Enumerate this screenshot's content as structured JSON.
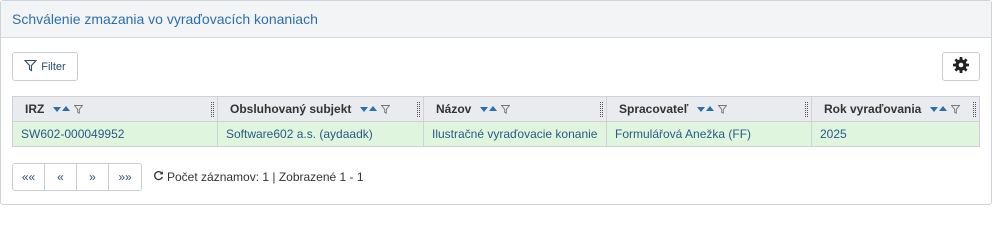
{
  "panel": {
    "title": "Schválenie zmazania vo vyraďovacích konaniach"
  },
  "toolbar": {
    "filter_label": "Filter",
    "filter_icon": "filter-icon",
    "settings_icon": "gear-icon"
  },
  "table": {
    "columns": [
      "IRZ",
      "Obsluhovaný subjekt",
      "Názov",
      "Spracovateľ",
      "Rok vyraďovania"
    ],
    "rows": [
      [
        "SW602-000049952",
        "Software602 a.s. (aydaadk)",
        "Ilustračné vyraďovacie konanie",
        "Formulářová Anežka (FF)",
        "2025"
      ]
    ]
  },
  "pager": {
    "first": "««",
    "prev": "«",
    "next": "»",
    "last": "»»"
  },
  "status": {
    "text": "Počet záznamov: 1 | Zobrazené 1 - 1",
    "icon": "refresh-icon"
  },
  "colors": {
    "accent": "#2a6fb0",
    "row_highlight": "#dff5de",
    "header_bg": "#f3f4f5"
  }
}
